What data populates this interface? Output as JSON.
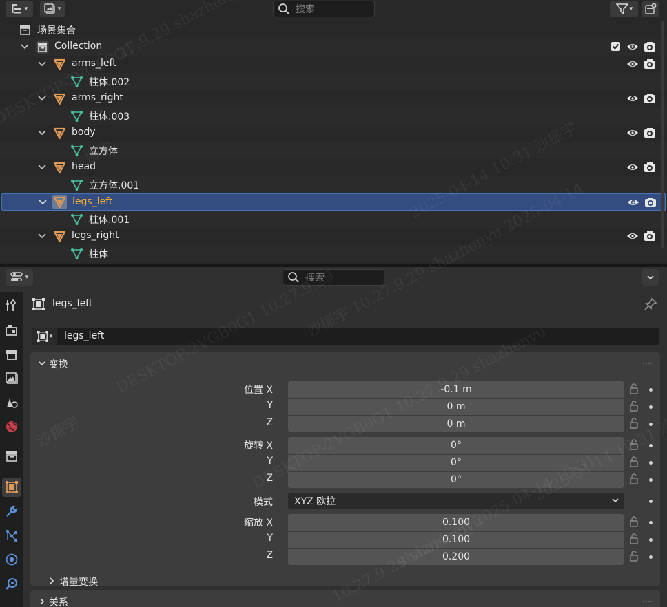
{
  "outliner": {
    "search_placeholder": "搜索",
    "scene_collection": "场景集合",
    "rows": [
      {
        "label": "Collection",
        "kind": "collection"
      },
      {
        "label": "arms_left",
        "kind": "object"
      },
      {
        "label": "柱体.002",
        "kind": "mesh"
      },
      {
        "label": "arms_right",
        "kind": "object"
      },
      {
        "label": "柱体.003",
        "kind": "mesh"
      },
      {
        "label": "body",
        "kind": "object"
      },
      {
        "label": "立方体",
        "kind": "mesh"
      },
      {
        "label": "head",
        "kind": "object"
      },
      {
        "label": "立方体.001",
        "kind": "mesh"
      },
      {
        "label": "legs_left",
        "kind": "object",
        "selected": true
      },
      {
        "label": "柱体.001",
        "kind": "mesh"
      },
      {
        "label": "legs_right",
        "kind": "object"
      },
      {
        "label": "柱体",
        "kind": "mesh"
      }
    ]
  },
  "properties": {
    "search_placeholder": "搜索",
    "context_name": "legs_left",
    "object_name": "legs_left",
    "transform": {
      "title": "变换",
      "location_label": "位置 X",
      "rotation_label": "旋转 X",
      "mode_label": "模式",
      "scale_label": "缩放 X",
      "axis_y": "Y",
      "axis_z": "Z",
      "location": [
        "-0.1 m",
        "0 m",
        "0 m"
      ],
      "rotation": [
        "0°",
        "0°",
        "0°"
      ],
      "mode_value": "XYZ 欧拉",
      "scale": [
        "0.100",
        "0.100",
        "0.200"
      ]
    },
    "delta_transform_title": "增量变换",
    "relations_title": "关系"
  },
  "watermarks": [
    "27.9.29 shazhenyu",
    "DESKTOP-2VGB0G1",
    "2025-04-14 10:31 沙振宇",
    "沙振宇 10.27.9.29 shazhenyu 2025-04-14",
    "DESKTOP-2VGB0G1 10.27.9.29",
    "沙振宇",
    "2025-04-14 10:31 沙振宇",
    "shazhenyu 2025-04-14 10:31",
    "10.27.9.29 shazhenyu",
    "沙振宇",
    "DESKTOP-2VGB0G1 10.27.9.29 shazhenyu"
  ],
  "colors": {
    "selected_row": "#334d80",
    "selected_text": "#ffaf29",
    "object_orange": "#e09a57",
    "mesh_green": "#47c2a1",
    "field": "#545454",
    "panel": "#3d3d3d"
  }
}
